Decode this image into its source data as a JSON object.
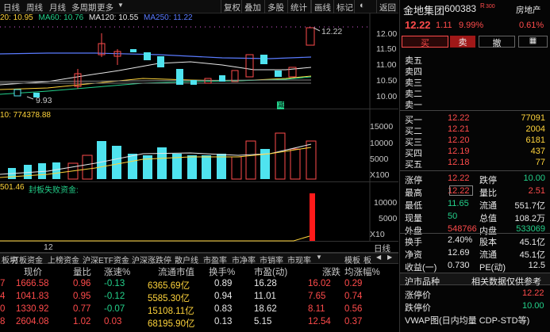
{
  "toolbar": {
    "items": [
      "日线",
      "周线",
      "月线",
      "多周期",
      "更多"
    ],
    "right_items": [
      "复权",
      "叠加",
      "多股",
      "统计",
      "画线",
      "标记",
      "返回"
    ]
  },
  "ma_legend": {
    "ma20": "20: 10.95",
    "ma60": "MA60: 10.76",
    "ma120": "MA120: 10.55",
    "ma250": "MA250: 11.22"
  },
  "price_axis": [
    "12.00",
    "11.50",
    "11.00",
    "10.50",
    "10.00"
  ],
  "price_marks": {
    "high": "12.22",
    "low": "9.93"
  },
  "volume_label": "10: 774378.88",
  "volume_axis": [
    "15000",
    "10000",
    "5000",
    "X100"
  ],
  "seal_label": "501.46",
  "seal_title": "封板失败资金:",
  "seal_axis": [
    "10000",
    "5000",
    "X10"
  ],
  "date_label": "12",
  "period_label": "日线",
  "bottom_tabs": [
    "板块",
    "打板资金",
    "上榜资金",
    "沪深ETF资金",
    "沪深涨跌停",
    "散户线",
    "市盈率",
    "市净率",
    "市销率",
    "市现率",
    "模板",
    "板"
  ],
  "table": {
    "headers": [
      "现价",
      "量比",
      "涨速%",
      "流通市值",
      "换手%",
      "市盈(动)",
      "涨跌",
      "均涨幅%"
    ],
    "rows": [
      [
        "7",
        "1666.58",
        "0.96",
        "-0.13",
        "6365.69亿",
        "0.89",
        "16.28",
        "16.02",
        "0.29"
      ],
      [
        "4",
        "1041.83",
        "0.95",
        "-0.12",
        "5585.30亿",
        "0.94",
        "11.01",
        "7.65",
        "0.74"
      ],
      [
        "0",
        "1330.92",
        "0.77",
        "-0.07",
        "15108.11亿",
        "0.83",
        "18.62",
        "8.11",
        "0.56"
      ],
      [
        "8",
        "2604.08",
        "1.02",
        "0.03",
        "68195.90亿",
        "0.13",
        "5.15",
        "12.54",
        "0.37"
      ]
    ]
  },
  "stock": {
    "name": "金地集团",
    "code": "600383",
    "tag": "R",
    "tag_num": "300",
    "industry": "房地产",
    "price": "12.22",
    "change": "1.11",
    "pct": "9.99%",
    "industry_pct": "0.61%",
    "buy_btn": "买",
    "sell_btn": "卖",
    "cancel_btn": "撤",
    "grid_icon": "grid-icon"
  },
  "asks": [
    "卖五",
    "卖四",
    "卖三",
    "卖二",
    "卖一"
  ],
  "bids": [
    {
      "label": "买一",
      "price": "12.22",
      "vol": "77091"
    },
    {
      "label": "买二",
      "price": "12.21",
      "vol": "2004"
    },
    {
      "label": "买三",
      "price": "12.20",
      "vol": "6181"
    },
    {
      "label": "买四",
      "price": "12.19",
      "vol": "437"
    },
    {
      "label": "买五",
      "price": "12.18",
      "vol": "77"
    }
  ],
  "stats": [
    {
      "l1": "涨停",
      "v1": "12.22",
      "l2": "跌停",
      "v2": "10.00"
    },
    {
      "l1": "最高",
      "v1": "12.22",
      "l2": "量比",
      "v2": "2.51"
    },
    {
      "l1": "最低",
      "v1": "11.65",
      "l2": "流通",
      "v2": "551.7亿"
    },
    {
      "l1": "现量",
      "v1": "50",
      "l2": "总值",
      "v2": "108.2万"
    },
    {
      "l1": "外盘",
      "v1": "548766",
      "l2": "内盘",
      "v2": "533069"
    }
  ],
  "stats2": [
    {
      "l1": "换手",
      "v1": "2.40%",
      "l2": "股本",
      "v2": "45.1亿"
    },
    {
      "l1": "净资",
      "v1": "12.69",
      "l2": "流通",
      "v2": "45.1亿"
    },
    {
      "l1": "收益(一)",
      "v1": "0.730",
      "l2": "PE(动)",
      "v2": "12.5"
    }
  ],
  "bottom_panel": {
    "tab1": "沪市品种",
    "tab2": "相关数据仅供参考",
    "limit_up_label": "涨停价",
    "limit_up": "12.22",
    "limit_down_label": "跌停价",
    "limit_down": "10.00",
    "vwap": "VWAP图(日内均量 CDP-STD等)"
  }
}
